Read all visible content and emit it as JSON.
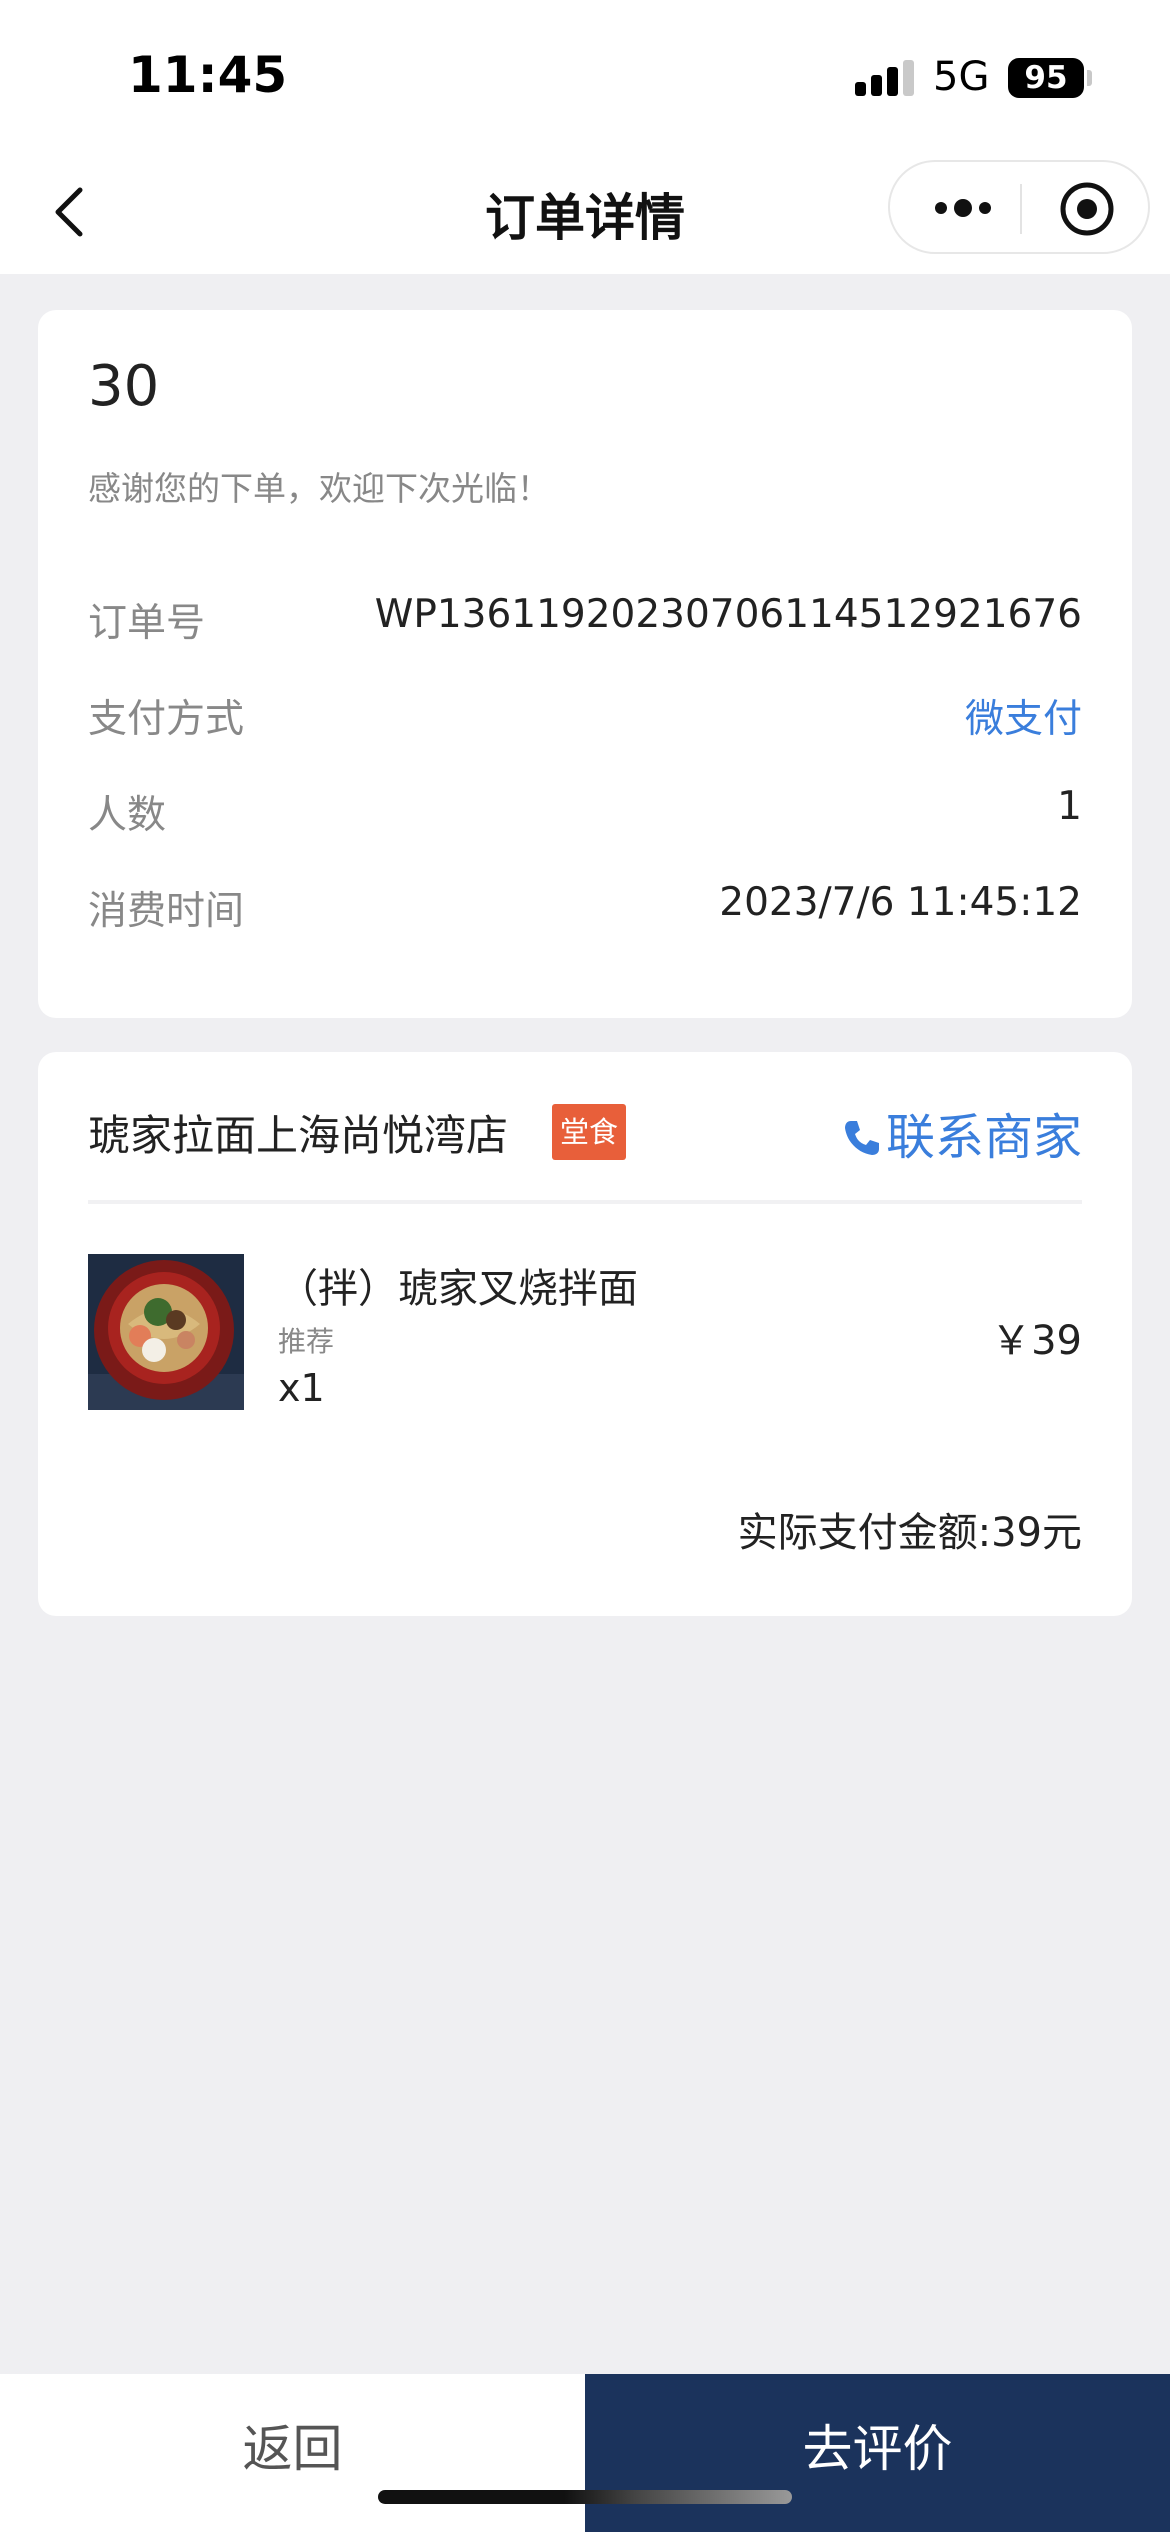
{
  "status_bar": {
    "time": "11:45",
    "network": "5G",
    "battery": "95"
  },
  "nav": {
    "title": "订单详情"
  },
  "order": {
    "number": "30",
    "thanks": "感谢您的下单，欢迎下次光临！",
    "rows": [
      {
        "label": "订单号",
        "value": "WP1361192023070611451292​1676"
      },
      {
        "label": "支付方式",
        "value": "微支付"
      },
      {
        "label": "人数",
        "value": "1"
      },
      {
        "label": "消费时间",
        "value": "2023/7/6 11:45:12"
      }
    ]
  },
  "shop": {
    "name": "琥家拉面上海尚悦湾店",
    "badge": "堂食",
    "contact_label": "联系商家",
    "items": [
      {
        "name": "（拌）琥家叉烧拌面",
        "tag": "推荐",
        "qty": "x1",
        "price": "￥39"
      }
    ],
    "total": "实际支付金额:39元"
  },
  "bottom": {
    "back_label": "返回",
    "review_label": "去评价"
  },
  "colors": {
    "accent_blue": "#3a7edc",
    "badge_orange": "#e85f3a",
    "navy": "#1b335c"
  }
}
